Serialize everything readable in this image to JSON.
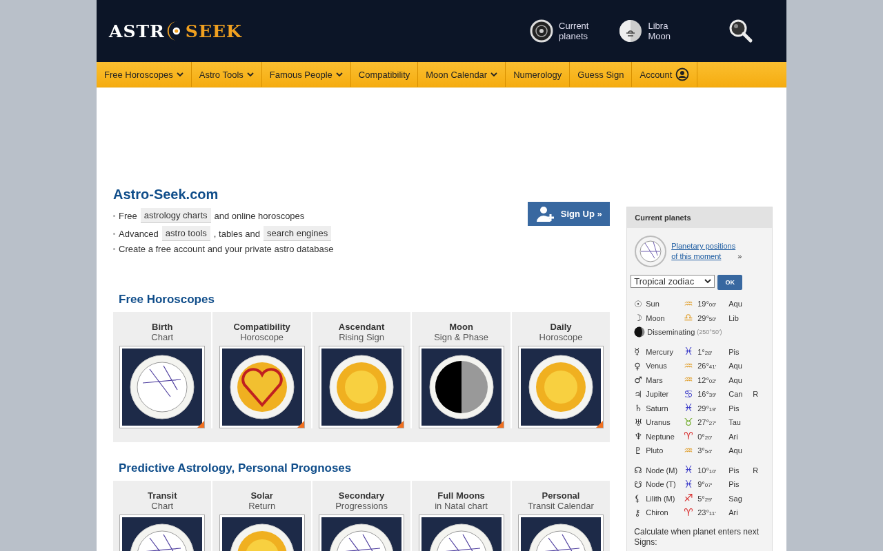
{
  "header": {
    "logo": {
      "left": "ASTR",
      "right": "SEEK"
    },
    "links": [
      {
        "kind": "planets",
        "line1": "Current",
        "line2": "planets"
      },
      {
        "kind": "moon",
        "line1": "Libra",
        "line2": "Moon"
      }
    ]
  },
  "nav": [
    {
      "label": "Free Horoscopes",
      "dropdown": true
    },
    {
      "label": "Astro Tools",
      "dropdown": true
    },
    {
      "label": "Famous People",
      "dropdown": true
    },
    {
      "label": "Compatibility",
      "dropdown": false
    },
    {
      "label": "Moon Calendar",
      "dropdown": true
    },
    {
      "label": "Numerology",
      "dropdown": false
    },
    {
      "label": "Guess Sign",
      "dropdown": false
    },
    {
      "label": "Account",
      "dropdown": false,
      "account": true
    }
  ],
  "intro": {
    "title": "Astro-Seek.com",
    "signup": "Sign Up »",
    "bullets": [
      [
        {
          "t": "Free"
        },
        {
          "t": "astrology charts",
          "link": true
        },
        {
          "t": "and online horoscopes"
        }
      ],
      [
        {
          "t": "Advanced"
        },
        {
          "t": "astro tools",
          "link": true
        },
        {
          "t": ", tables and"
        },
        {
          "t": "search engines",
          "link": true
        }
      ],
      [
        {
          "t": "Create a free account and your private astro database"
        }
      ]
    ]
  },
  "sections": [
    {
      "title": "Free Horoscopes",
      "cards": [
        {
          "title": "Birth",
          "subtitle": "Chart",
          "kind": "chart"
        },
        {
          "title": "Compatibility",
          "subtitle": "Horoscope",
          "kind": "heart"
        },
        {
          "title": "Ascendant",
          "subtitle": "Rising Sign",
          "kind": "sun"
        },
        {
          "title": "Moon",
          "subtitle": "Sign & Phase",
          "kind": "moon"
        },
        {
          "title": "Daily",
          "subtitle": "Horoscope",
          "kind": "sun"
        }
      ]
    },
    {
      "title": "Predictive Astrology, Personal Prognoses",
      "cards": [
        {
          "title": "Transit",
          "subtitle": "Chart",
          "kind": "chart"
        },
        {
          "title": "Solar",
          "subtitle": "Return",
          "kind": "sun"
        },
        {
          "title": "Secondary",
          "subtitle": "Progressions",
          "kind": "chart"
        },
        {
          "title": "Full Moons",
          "subtitle": "in Natal chart",
          "kind": "chart"
        },
        {
          "title": "Personal",
          "subtitle": "Transit Calendar",
          "kind": "chart"
        }
      ]
    }
  ],
  "sidebar": {
    "title": "Current planets",
    "link_line1": "Planetary positions",
    "link_line2": "of this moment",
    "link_suffix": "»",
    "zodiac_select": "Tropical zodiac",
    "ok": "OK",
    "groups": [
      [
        {
          "glyph": "☉",
          "name": "Sun",
          "sign_glyph": "♒",
          "color": "#e0a030",
          "deg": "19°",
          "min": "00′",
          "sign": "Aqu"
        },
        {
          "glyph": "☽",
          "name": "Moon",
          "sign_glyph": "♎",
          "color": "#e0a030",
          "deg": "29°",
          "min": "50′",
          "sign": "Lib"
        }
      ],
      [
        {
          "glyph": "☿",
          "name": "Mercury",
          "sign_glyph": "♓",
          "color": "#3a3ac8",
          "deg": "1°",
          "min": "28′",
          "sign": "Pis"
        },
        {
          "glyph": "♀",
          "name": "Venus",
          "sign_glyph": "♒",
          "color": "#e0a030",
          "deg": "26°",
          "min": "41′",
          "sign": "Aqu"
        },
        {
          "glyph": "♂",
          "name": "Mars",
          "sign_glyph": "♒",
          "color": "#e0a030",
          "deg": "12°",
          "min": "02′",
          "sign": "Aqu"
        },
        {
          "glyph": "♃",
          "name": "Jupiter",
          "sign_glyph": "♋",
          "color": "#3a3ac8",
          "deg": "16°",
          "min": "39′",
          "sign": "Can",
          "retro": "R"
        },
        {
          "glyph": "♄",
          "name": "Saturn",
          "sign_glyph": "♓",
          "color": "#3a3ac8",
          "deg": "29°",
          "min": "19′",
          "sign": "Pis"
        },
        {
          "glyph": "♅",
          "name": "Uranus",
          "sign_glyph": "♉",
          "color": "#6aa820",
          "deg": "27°",
          "min": "27′",
          "sign": "Tau"
        },
        {
          "glyph": "♆",
          "name": "Neptune",
          "sign_glyph": "♈",
          "color": "#d83030",
          "deg": "0°",
          "min": "20′",
          "sign": "Ari"
        },
        {
          "glyph": "♇",
          "name": "Pluto",
          "sign_glyph": "♒",
          "color": "#e0a030",
          "deg": "3°",
          "min": "54′",
          "sign": "Aqu"
        }
      ],
      [
        {
          "glyph": "☊",
          "name": "Node (M)",
          "sign_glyph": "♓",
          "color": "#3a3ac8",
          "deg": "10°",
          "min": "10′",
          "sign": "Pis",
          "retro": "R"
        },
        {
          "glyph": "☋",
          "name": "Node (T)",
          "sign_glyph": "♓",
          "color": "#3a3ac8",
          "deg": "9°",
          "min": "07′",
          "sign": "Pis"
        },
        {
          "glyph": "⚸",
          "name": "Lilith (M)",
          "sign_glyph": "♐",
          "color": "#d83030",
          "deg": "5°",
          "min": "29′",
          "sign": "Sag"
        },
        {
          "glyph": "⚷",
          "name": "Chiron",
          "sign_glyph": "♈",
          "color": "#d83030",
          "deg": "23°",
          "min": "11′",
          "sign": "Ari"
        }
      ]
    ],
    "phase": {
      "name": "Disseminating",
      "angle": "(250°50′)"
    },
    "footer": "Calculate when planet enters next Signs:"
  }
}
